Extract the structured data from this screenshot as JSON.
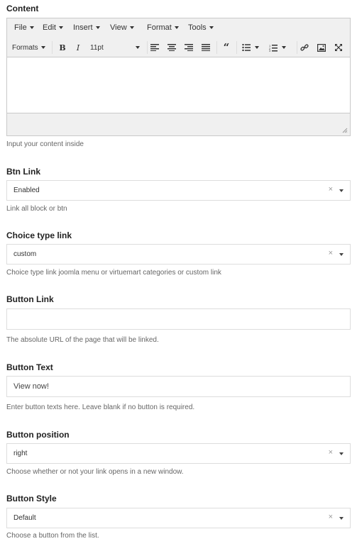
{
  "content": {
    "label": "Content",
    "help": "Input your content inside",
    "menu": [
      "File",
      "Edit",
      "Insert",
      "View",
      "Format",
      "Tools"
    ],
    "formats_label": "Formats",
    "font_size": "11pt"
  },
  "btn_link": {
    "label": "Btn Link",
    "value": "Enabled",
    "help": "Link all block or btn"
  },
  "choice_type_link": {
    "label": "Choice type link",
    "value": "custom",
    "help": "Choice type link joomla menu or virtuemart categories or custom link"
  },
  "button_link": {
    "label": "Button Link",
    "value": "",
    "help": "The absolute URL of the page that will be linked."
  },
  "button_text": {
    "label": "Button Text",
    "value": "View now!",
    "help": "Enter button texts here. Leave blank if no button is required."
  },
  "button_position": {
    "label": "Button position",
    "value": "right",
    "help": "Choose whether or not your link opens in a new window."
  },
  "button_style": {
    "label": "Button Style",
    "value": "Default",
    "help": "Choose a button from the list."
  },
  "clear_glyph": "×",
  "icons": [
    "bold-icon",
    "italic-icon",
    "align-left-icon",
    "align-center-icon",
    "align-right-icon",
    "justify-icon",
    "blockquote-icon",
    "bullet-list-icon",
    "numbered-list-icon",
    "link-icon",
    "image-icon",
    "fullscreen-icon",
    "resize-handle-icon"
  ]
}
